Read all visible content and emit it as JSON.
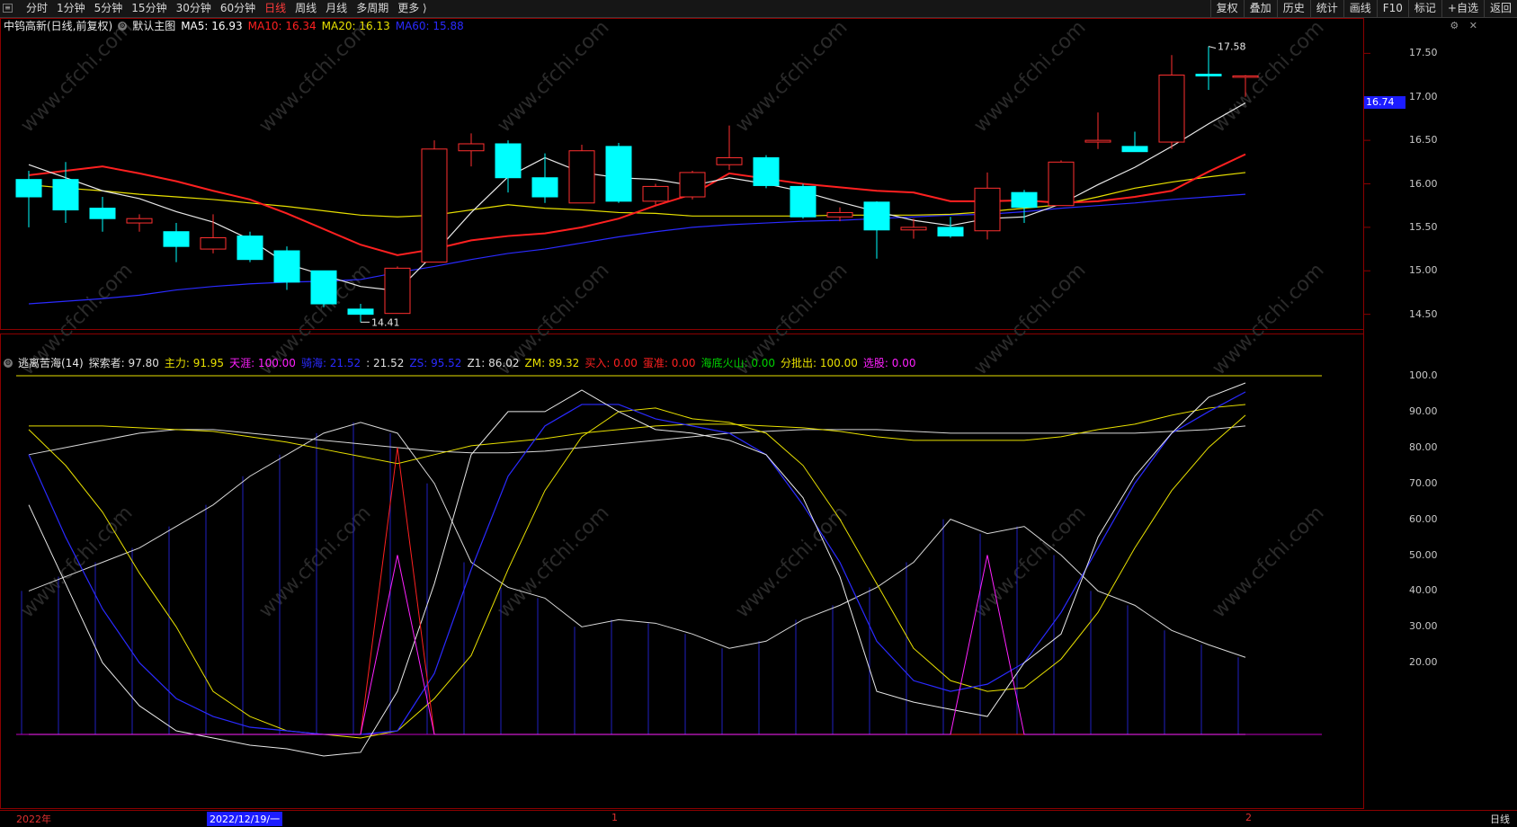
{
  "toolbar": {
    "periods": [
      "分时",
      "1分钟",
      "5分钟",
      "15分钟",
      "30分钟",
      "60分钟",
      "日线",
      "周线",
      "月线",
      "多周期",
      "更多 ⟩"
    ],
    "active_period": "日线",
    "tools": [
      "复权",
      "叠加",
      "历史",
      "统计",
      "画线",
      "F10",
      "标记",
      "+自选",
      "返回"
    ]
  },
  "main": {
    "stock": "中钨高新(日线,前复权)",
    "template": "默认主图",
    "ma": [
      {
        "label": "MA5:",
        "value": "16.93",
        "color": "#ffffff"
      },
      {
        "label": "MA10:",
        "value": "16.34",
        "color": "#ff2020"
      },
      {
        "label": "MA20:",
        "value": "16.13",
        "color": "#e8e000"
      },
      {
        "label": "MA60:",
        "value": "15.88",
        "color": "#2a2aff"
      }
    ],
    "price_labels": [
      "17.50",
      "17.00",
      "16.50",
      "16.00",
      "15.50",
      "15.00",
      "14.50"
    ],
    "current_price": "16.74",
    "high_label": "17.58",
    "low_label": "14.41"
  },
  "indicator": {
    "name": "逃离苦海(14)",
    "items": [
      {
        "label": "探索者:",
        "value": "97.80",
        "color": "#e0e0e0"
      },
      {
        "label": "主力:",
        "value": "91.95",
        "color": "#e8e000"
      },
      {
        "label": "天涯:",
        "value": "100.00",
        "color": "#ff20ff"
      },
      {
        "label": "骑海:",
        "value": "21.52",
        "color": "#2a2aff"
      },
      {
        "label": ":",
        "value": "21.52",
        "color": "#e0e0e0"
      },
      {
        "label": "ZS:",
        "value": "95.52",
        "color": "#2a2aff"
      },
      {
        "label": "Z1:",
        "value": "86.02",
        "color": "#e0e0e0"
      },
      {
        "label": "ZM:",
        "value": "89.32",
        "color": "#e8e000"
      },
      {
        "label": "买入:",
        "value": "0.00",
        "color": "#ff2020"
      },
      {
        "label": "蛋准:",
        "value": "0.00",
        "color": "#ff2020"
      },
      {
        "label": "海底火山:",
        "value": "0.00",
        "color": "#00d000"
      },
      {
        "label": "分批出:",
        "value": "100.00",
        "color": "#e8e000"
      },
      {
        "label": "选股:",
        "value": "0.00",
        "color": "#ff20ff"
      }
    ],
    "y_labels": [
      "100.0",
      "90.00",
      "80.00",
      "70.00",
      "60.00",
      "50.00",
      "40.00",
      "30.00",
      "20.00"
    ]
  },
  "bottom": {
    "year": "2022年",
    "cursor_date": "2022/12/19/一",
    "month1": "1",
    "month2": "2",
    "period": "日线"
  },
  "watermark": "www.cfchi.com",
  "chart_data": {
    "type": "candlestick",
    "price_range": [
      14.3,
      17.7
    ],
    "candles": [
      {
        "o": 16.05,
        "h": 16.15,
        "l": 15.5,
        "c": 15.85
      },
      {
        "o": 16.05,
        "h": 16.25,
        "l": 15.55,
        "c": 15.7
      },
      {
        "o": 15.72,
        "h": 15.85,
        "l": 15.45,
        "c": 15.6
      },
      {
        "o": 15.55,
        "h": 15.65,
        "l": 15.45,
        "c": 15.6
      },
      {
        "o": 15.45,
        "h": 15.55,
        "l": 15.1,
        "c": 15.28
      },
      {
        "o": 15.25,
        "h": 15.65,
        "l": 15.2,
        "c": 15.38
      },
      {
        "o": 15.4,
        "h": 15.45,
        "l": 15.1,
        "c": 15.13
      },
      {
        "o": 15.23,
        "h": 15.28,
        "l": 14.78,
        "c": 14.87
      },
      {
        "o": 15.0,
        "h": 15.0,
        "l": 14.58,
        "c": 14.62
      },
      {
        "o": 14.56,
        "h": 14.62,
        "l": 14.41,
        "c": 14.5
      },
      {
        "o": 14.51,
        "h": 15.05,
        "l": 14.51,
        "c": 15.03
      },
      {
        "o": 15.1,
        "h": 16.5,
        "l": 15.1,
        "c": 16.4
      },
      {
        "o": 16.38,
        "h": 16.58,
        "l": 16.2,
        "c": 16.46
      },
      {
        "o": 16.46,
        "h": 16.5,
        "l": 15.9,
        "c": 16.07
      },
      {
        "o": 16.07,
        "h": 16.35,
        "l": 15.78,
        "c": 15.85
      },
      {
        "o": 15.78,
        "h": 16.45,
        "l": 15.78,
        "c": 16.38
      },
      {
        "o": 16.43,
        "h": 16.47,
        "l": 15.78,
        "c": 15.8
      },
      {
        "o": 15.8,
        "h": 16.0,
        "l": 15.76,
        "c": 15.97
      },
      {
        "o": 15.85,
        "h": 16.15,
        "l": 15.82,
        "c": 16.13
      },
      {
        "o": 16.22,
        "h": 16.67,
        "l": 16.16,
        "c": 16.3
      },
      {
        "o": 16.3,
        "h": 16.33,
        "l": 15.95,
        "c": 15.98
      },
      {
        "o": 15.97,
        "h": 16.0,
        "l": 15.6,
        "c": 15.62
      },
      {
        "o": 15.62,
        "h": 15.73,
        "l": 15.57,
        "c": 15.67
      },
      {
        "o": 15.79,
        "h": 15.8,
        "l": 15.14,
        "c": 15.47
      },
      {
        "o": 15.47,
        "h": 15.6,
        "l": 15.37,
        "c": 15.5
      },
      {
        "o": 15.5,
        "h": 15.62,
        "l": 15.38,
        "c": 15.4
      },
      {
        "o": 15.46,
        "h": 16.13,
        "l": 15.36,
        "c": 15.95
      },
      {
        "o": 15.9,
        "h": 15.93,
        "l": 15.55,
        "c": 15.73
      },
      {
        "o": 15.75,
        "h": 16.27,
        "l": 15.75,
        "c": 16.25
      },
      {
        "o": 16.48,
        "h": 16.82,
        "l": 16.4,
        "c": 16.5
      },
      {
        "o": 16.43,
        "h": 16.6,
        "l": 16.37,
        "c": 16.37
      },
      {
        "o": 16.48,
        "h": 17.48,
        "l": 16.4,
        "c": 17.25
      },
      {
        "o": 17.26,
        "h": 17.58,
        "l": 17.08,
        "c": 17.24
      },
      {
        "o": 17.24,
        "h": 17.25,
        "l": 17.0,
        "c": 17.24
      }
    ],
    "ma5": [
      16.22,
      16.07,
      15.92,
      15.83,
      15.68,
      15.56,
      15.36,
      15.08,
      14.95,
      14.82,
      14.77,
      15.2,
      15.67,
      16.08,
      16.3,
      16.13,
      16.07,
      16.05,
      15.98,
      16.07,
      16.0,
      15.91,
      15.79,
      15.68,
      15.58,
      15.52,
      15.6,
      15.62,
      15.77,
      15.99,
      16.19,
      16.43,
      16.69,
      16.93
    ],
    "ma10": [
      16.1,
      16.15,
      16.2,
      16.12,
      16.03,
      15.92,
      15.82,
      15.66,
      15.48,
      15.3,
      15.18,
      15.25,
      15.35,
      15.4,
      15.43,
      15.5,
      15.6,
      15.75,
      15.88,
      16.12,
      16.06,
      16.0,
      15.96,
      15.92,
      15.9,
      15.8,
      15.8,
      15.81,
      15.78,
      15.8,
      15.85,
      15.92,
      16.14,
      16.34
    ],
    "ma20": [
      15.99,
      15.95,
      15.92,
      15.88,
      15.85,
      15.82,
      15.78,
      15.74,
      15.69,
      15.64,
      15.62,
      15.64,
      15.7,
      15.76,
      15.72,
      15.7,
      15.67,
      15.66,
      15.63,
      15.63,
      15.63,
      15.63,
      15.64,
      15.64,
      15.64,
      15.65,
      15.68,
      15.72,
      15.76,
      15.85,
      15.95,
      16.02,
      16.08,
      16.13
    ],
    "ma60": [
      14.62,
      14.65,
      14.68,
      14.72,
      14.78,
      14.82,
      14.85,
      14.87,
      14.88,
      14.9,
      14.98,
      15.05,
      15.13,
      15.2,
      15.25,
      15.32,
      15.39,
      15.45,
      15.5,
      15.53,
      15.55,
      15.57,
      15.58,
      15.6,
      15.62,
      15.64,
      15.65,
      15.68,
      15.72,
      15.75,
      15.78,
      15.82,
      15.85,
      15.88
    ],
    "explorer": [
      78,
      80,
      82,
      84,
      85,
      85,
      84,
      83,
      82,
      81,
      80,
      79,
      78.5,
      78.5,
      79,
      80,
      81,
      82,
      83,
      84,
      84.5,
      85,
      85,
      85,
      84.5,
      84,
      84,
      84,
      84,
      84,
      84,
      84.5,
      85,
      86
    ],
    "main_force": [
      86,
      86,
      86,
      85.5,
      85,
      84.5,
      83,
      81.5,
      79.5,
      77.5,
      75.5,
      78,
      80.5,
      81.5,
      82.5,
      84,
      85,
      86,
      86.5,
      86.5,
      86,
      85.5,
      84.5,
      83,
      82,
      82,
      82,
      82,
      83,
      85,
      86.5,
      89,
      91,
      92
    ],
    "sky": [
      0,
      0,
      0,
      0,
      0,
      0,
      0,
      0,
      0,
      0,
      50,
      0,
      0,
      0,
      0,
      0,
      0,
      0,
      0,
      0,
      0,
      0,
      0,
      0,
      0,
      0,
      50,
      0,
      0,
      0,
      0,
      0,
      0,
      0
    ],
    "buy": [
      0,
      0,
      0,
      0,
      0,
      0,
      0,
      0,
      0,
      0,
      80,
      0,
      0,
      0,
      0,
      0,
      0,
      0,
      0,
      0,
      0,
      0,
      0,
      0,
      0,
      0,
      0,
      0,
      0,
      0,
      0,
      0,
      0,
      0
    ],
    "rider": [
      40,
      44,
      48,
      52,
      58,
      64,
      72,
      78,
      84,
      87,
      84,
      70,
      48,
      41,
      38,
      30,
      32,
      31,
      28,
      24,
      26,
      32,
      36,
      41,
      48,
      60,
      56,
      58,
      50,
      40,
      36,
      29,
      25,
      21.5
    ],
    "z1": [
      64,
      42,
      20,
      8,
      1,
      -1,
      -3,
      -4,
      -6,
      -5,
      12,
      42,
      78,
      90,
      90,
      96,
      90,
      85,
      84,
      82,
      78,
      66,
      44,
      12,
      9,
      7,
      5,
      20,
      28,
      55,
      72,
      84,
      94,
      98
    ],
    "zs": [
      78,
      55,
      35,
      20,
      10,
      5,
      2,
      1,
      0,
      0,
      1,
      17,
      46,
      72,
      86,
      92,
      92,
      88,
      86,
      84,
      78,
      64,
      48,
      26,
      15,
      12,
      14,
      20,
      34,
      52,
      70,
      84,
      90,
      95.5
    ],
    "zm": [
      85,
      75,
      62,
      45,
      30,
      12,
      5,
      1,
      0,
      -1,
      1,
      10,
      22,
      46,
      68,
      83,
      90,
      91,
      88,
      87,
      84,
      75,
      60,
      42,
      24,
      15,
      12,
      13,
      21,
      34,
      52,
      68,
      80,
      89
    ]
  }
}
